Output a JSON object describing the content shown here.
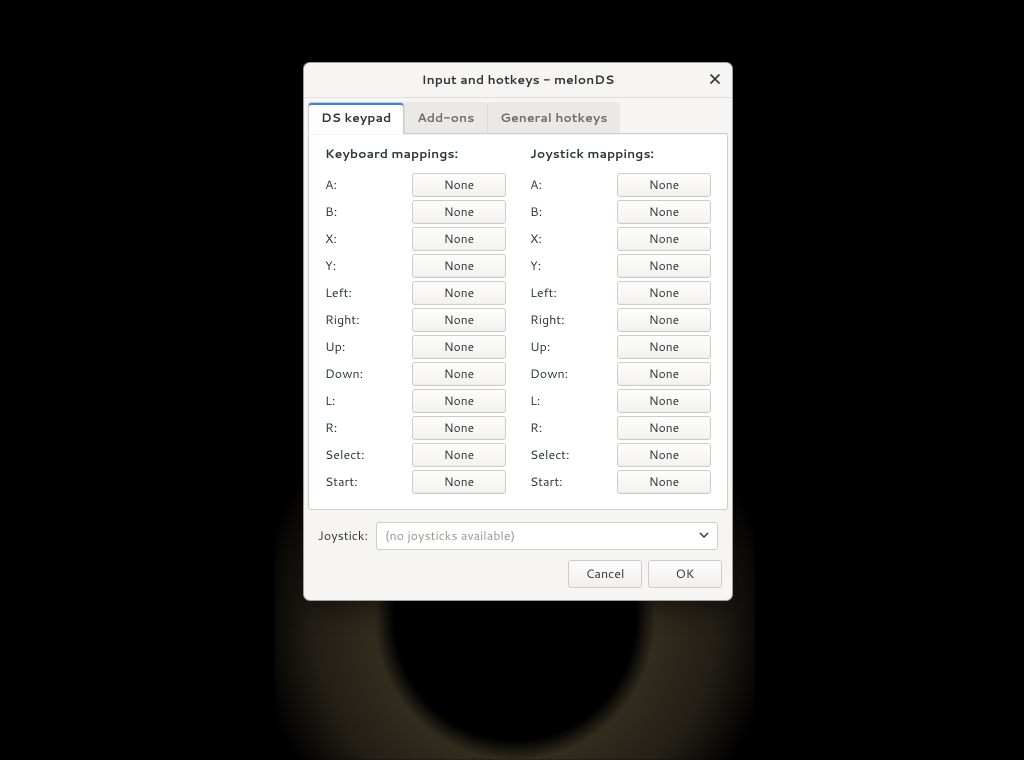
{
  "dialog": {
    "title": "Input and hotkeys - melonDS"
  },
  "tabs": {
    "ds_keypad": "DS keypad",
    "addons": "Add-ons",
    "general_hotkeys": "General hotkeys",
    "active": "ds_keypad"
  },
  "headings": {
    "keyboard": "Keyboard mappings:",
    "joystick": "Joystick mappings:"
  },
  "keys": [
    "A",
    "B",
    "X",
    "Y",
    "Left",
    "Right",
    "Up",
    "Down",
    "L",
    "R",
    "Select",
    "Start"
  ],
  "mappings": {
    "keyboard": {
      "A": "None",
      "B": "None",
      "X": "None",
      "Y": "None",
      "Left": "None",
      "Right": "None",
      "Up": "None",
      "Down": "None",
      "L": "None",
      "R": "None",
      "Select": "None",
      "Start": "None"
    },
    "joystick": {
      "A": "None",
      "B": "None",
      "X": "None",
      "Y": "None",
      "Left": "None",
      "Right": "None",
      "Up": "None",
      "Down": "None",
      "L": "None",
      "R": "None",
      "Select": "None",
      "Start": "None"
    }
  },
  "joystick_selector": {
    "label": "Joystick:",
    "value": "(no joysticks available)"
  },
  "buttons": {
    "cancel": "Cancel",
    "ok": "OK"
  }
}
